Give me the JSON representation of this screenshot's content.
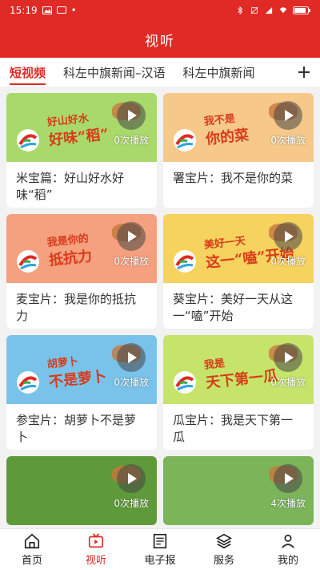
{
  "status": {
    "time": "15:19",
    "battery": ""
  },
  "header": {
    "title": "视听"
  },
  "tabs": [
    {
      "label": "短视频",
      "active": true
    },
    {
      "label": "科左中旗新闻–汉语",
      "active": false
    },
    {
      "label": "科左中旗新闻",
      "active": false
    }
  ],
  "cards": [
    {
      "headline": "好山好水",
      "headline2": "好味“稻”",
      "count": "0次播放",
      "title": "米宝篇：好山好水好味“稻”",
      "bg": "#a9d96b"
    },
    {
      "headline": "我不是",
      "headline2": "你的菜",
      "count": "0次播放",
      "title": "署宝片：我不是你的菜",
      "bg": "#f6c98b"
    },
    {
      "headline": "我是你的",
      "headline2": "抵抗力",
      "count": "0次播放",
      "title": "麦宝片：我是你的抵抗力",
      "bg": "#f5a07f"
    },
    {
      "headline": "美好一天",
      "headline2": "这一“嗑”开始",
      "count": "0次播放",
      "title": "葵宝片：美好一天从这一“嗑”开始",
      "bg": "#f6d25e"
    },
    {
      "headline": "胡萝卜",
      "headline2": "不是萝卜",
      "count": "0次播放",
      "title": "参宝片：胡萝卜不是萝卜",
      "bg": "#79c3ea"
    },
    {
      "headline": "我是",
      "headline2": "天下第一瓜",
      "count": "0次播放",
      "title": "瓜宝片：我是天下第一瓜",
      "bg": "#c6e46a"
    },
    {
      "headline": "",
      "headline2": "",
      "count": "0次播放",
      "title": "",
      "bg": "#5f9a3a"
    },
    {
      "headline": "",
      "headline2": "",
      "count": "4次播放",
      "title": "",
      "bg": "#7cb45a"
    }
  ],
  "bottom_nav": [
    {
      "label": "首页",
      "icon": "home-icon",
      "active": false
    },
    {
      "label": "视听",
      "icon": "tv-icon",
      "active": true
    },
    {
      "label": "电子报",
      "icon": "newspaper-icon",
      "active": false
    },
    {
      "label": "服务",
      "icon": "layers-icon",
      "active": false
    },
    {
      "label": "我的",
      "icon": "user-icon",
      "active": false
    }
  ],
  "colors": {
    "brand_red": "#e02a25"
  }
}
